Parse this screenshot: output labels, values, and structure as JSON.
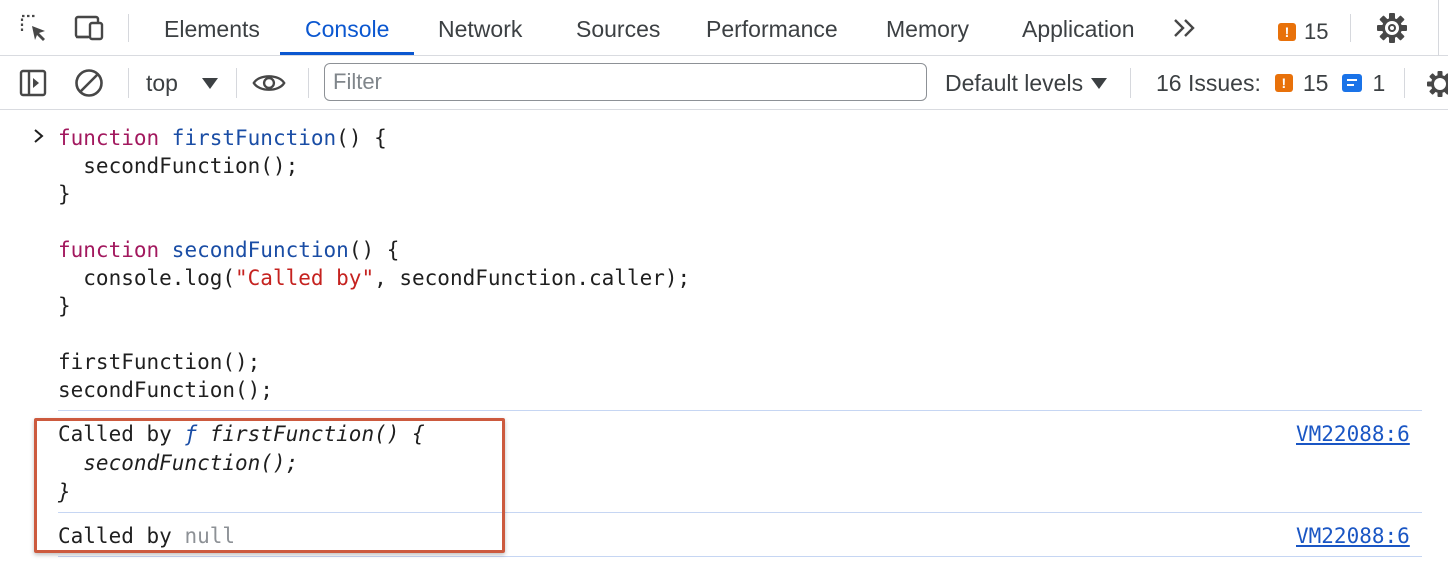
{
  "tabbar": {
    "tabs": [
      {
        "label": "Elements",
        "active": false
      },
      {
        "label": "Console",
        "active": true
      },
      {
        "label": "Network",
        "active": false
      },
      {
        "label": "Sources",
        "active": false
      },
      {
        "label": "Performance",
        "active": false
      },
      {
        "label": "Memory",
        "active": false
      },
      {
        "label": "Application",
        "active": false
      }
    ],
    "more_tabs_glyph": "»",
    "issue_badge": {
      "icon_glyph": "!",
      "count": "15"
    },
    "icons": [
      "inspect-element-icon",
      "device-toolbar-icon",
      "more-tabs-icon",
      "settings-gear-icon"
    ]
  },
  "toolbar": {
    "context": "top",
    "filter_placeholder": "Filter",
    "filter_value": "",
    "levels": "Default levels",
    "issues_label": "16 Issues:",
    "issues_warning_count": "15",
    "issues_info_count": "1",
    "warning_glyph": "!",
    "icons": [
      "sidebar-toggle-icon",
      "clear-console-icon",
      "live-expression-eye-icon",
      "console-settings-gear-icon"
    ]
  },
  "console": {
    "input_code": {
      "line1_kw": "function ",
      "line1_fn": "firstFunction",
      "line1_rest": "() {",
      "line2": "  secondFunction();",
      "line3": "}",
      "line5_kw": "function ",
      "line5_fn": "secondFunction",
      "line5_rest": "() {",
      "line6_pre": "  console.log(",
      "line6_str": "\"Called by\"",
      "line6_post": ", secondFunction.caller);",
      "line7": "}",
      "line9": "firstFunction();",
      "line10": "secondFunction();"
    },
    "messages": [
      {
        "prefix": "Called by ",
        "func_symbol": "ƒ",
        "line1": " firstFunction() {",
        "line2": "  secondFunction();",
        "line3": "}",
        "source": "VM22088:6"
      },
      {
        "prefix": "Called by ",
        "value": "null",
        "source": "VM22088:6"
      }
    ]
  },
  "colors": {
    "accent": "#0b57d0",
    "keyword": "#a2185e",
    "function_name": "#1a4da5",
    "string": "#c5221f",
    "warning": "#e8710a",
    "info": "#1a73e8",
    "highlight_box": "#cc5a3e"
  }
}
